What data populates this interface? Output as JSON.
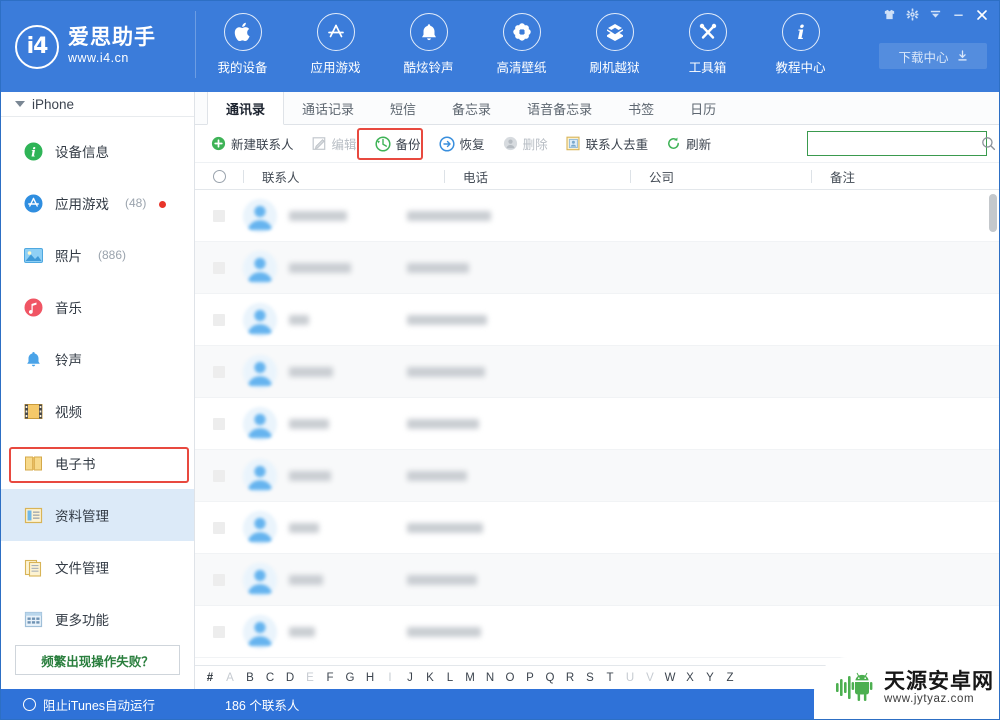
{
  "app": {
    "brand_name": "爱思助手",
    "brand_url": "www.i4.cn",
    "logo_text": "i4"
  },
  "topnav": {
    "items": [
      {
        "label": "我的设备",
        "icon": "apple-icon"
      },
      {
        "label": "应用游戏",
        "icon": "appstore-icon"
      },
      {
        "label": "酷炫铃声",
        "icon": "bell-icon"
      },
      {
        "label": "高清壁纸",
        "icon": "flower-icon"
      },
      {
        "label": "刷机越狱",
        "icon": "openbox-icon"
      },
      {
        "label": "工具箱",
        "icon": "tools-icon"
      },
      {
        "label": "教程中心",
        "icon": "info-icon"
      }
    ],
    "download_center": "下载中心",
    "window_controls": [
      "shirt-icon",
      "gear-icon",
      "chevron-down-icon",
      "minimize-icon",
      "close-icon"
    ]
  },
  "sidebar": {
    "device": "iPhone",
    "items": [
      {
        "label": "设备信息",
        "count": "",
        "icon": "info-circle-icon",
        "selected": false,
        "badge": false
      },
      {
        "label": "应用游戏",
        "count": "(48)",
        "icon": "appstore-blue-icon",
        "selected": false,
        "badge": true
      },
      {
        "label": "照片",
        "count": "(886)",
        "icon": "photo-icon",
        "selected": false,
        "badge": false
      },
      {
        "label": "音乐",
        "count": "",
        "icon": "music-icon",
        "selected": false,
        "badge": false
      },
      {
        "label": "铃声",
        "count": "",
        "icon": "ringtone-icon",
        "selected": false,
        "badge": false
      },
      {
        "label": "视频",
        "count": "",
        "icon": "film-icon",
        "selected": false,
        "badge": false
      },
      {
        "label": "电子书",
        "count": "",
        "icon": "book-icon",
        "selected": false,
        "badge": false
      },
      {
        "label": "资料管理",
        "count": "",
        "icon": "data-icon",
        "selected": true,
        "badge": false
      },
      {
        "label": "文件管理",
        "count": "",
        "icon": "files-icon",
        "selected": false,
        "badge": false
      },
      {
        "label": "更多功能",
        "count": "",
        "icon": "grid-icon",
        "selected": false,
        "badge": false
      }
    ],
    "fail_button": "频繁出现操作失败？"
  },
  "tabs": [
    {
      "label": "通讯录",
      "active": true
    },
    {
      "label": "通话记录",
      "active": false
    },
    {
      "label": "短信",
      "active": false
    },
    {
      "label": "备忘录",
      "active": false
    },
    {
      "label": "语音备忘录",
      "active": false
    },
    {
      "label": "书签",
      "active": false
    },
    {
      "label": "日历",
      "active": false
    }
  ],
  "toolbar": {
    "buttons": [
      {
        "label": "新建联系人",
        "icon": "plus-circle-icon",
        "disabled": false,
        "highlighted": false
      },
      {
        "label": "编辑",
        "icon": "edit-icon",
        "disabled": true,
        "highlighted": false
      },
      {
        "label": "备份",
        "icon": "backup-icon",
        "disabled": false,
        "highlighted": true
      },
      {
        "label": "恢复",
        "icon": "restore-icon",
        "disabled": false,
        "highlighted": false
      },
      {
        "label": "删除",
        "icon": "delete-icon",
        "disabled": true,
        "highlighted": false
      },
      {
        "label": "联系人去重",
        "icon": "dedupe-icon",
        "disabled": false,
        "highlighted": false
      },
      {
        "label": "刷新",
        "icon": "refresh-icon",
        "disabled": false,
        "highlighted": false
      }
    ],
    "search_value": "",
    "search_placeholder": ""
  },
  "table": {
    "columns": [
      "联系人",
      "电话",
      "公司",
      "备注"
    ],
    "rows": [
      {
        "name_w": 58,
        "phone_w": 84
      },
      {
        "name_w": 62,
        "phone_w": 62
      },
      {
        "name_w": 20,
        "phone_w": 80
      },
      {
        "name_w": 44,
        "phone_w": 78
      },
      {
        "name_w": 40,
        "phone_w": 72
      },
      {
        "name_w": 42,
        "phone_w": 60
      },
      {
        "name_w": 30,
        "phone_w": 76
      },
      {
        "name_w": 34,
        "phone_w": 70
      },
      {
        "name_w": 26,
        "phone_w": 74
      }
    ]
  },
  "alphabet": {
    "letters": [
      "#",
      "A",
      "B",
      "C",
      "D",
      "E",
      "F",
      "G",
      "H",
      "I",
      "J",
      "K",
      "L",
      "M",
      "N",
      "O",
      "P",
      "Q",
      "R",
      "S",
      "T",
      "U",
      "V",
      "W",
      "X",
      "Y",
      "Z"
    ],
    "dimmed": [
      "A",
      "E",
      "I",
      "U",
      "V"
    ]
  },
  "statusbar": {
    "itunes_toggle": "阻止iTunes自动运行",
    "contact_count": "186 个联系人"
  },
  "watermark": {
    "cn": "天源安卓网",
    "url": "www.jytyaz.com"
  },
  "colors": {
    "header_blue": "#3b7cda",
    "status_blue": "#2f72d8",
    "highlight_red": "#e8493f",
    "search_green": "#3a9a4e",
    "selected_bg": "#dceaf8"
  }
}
